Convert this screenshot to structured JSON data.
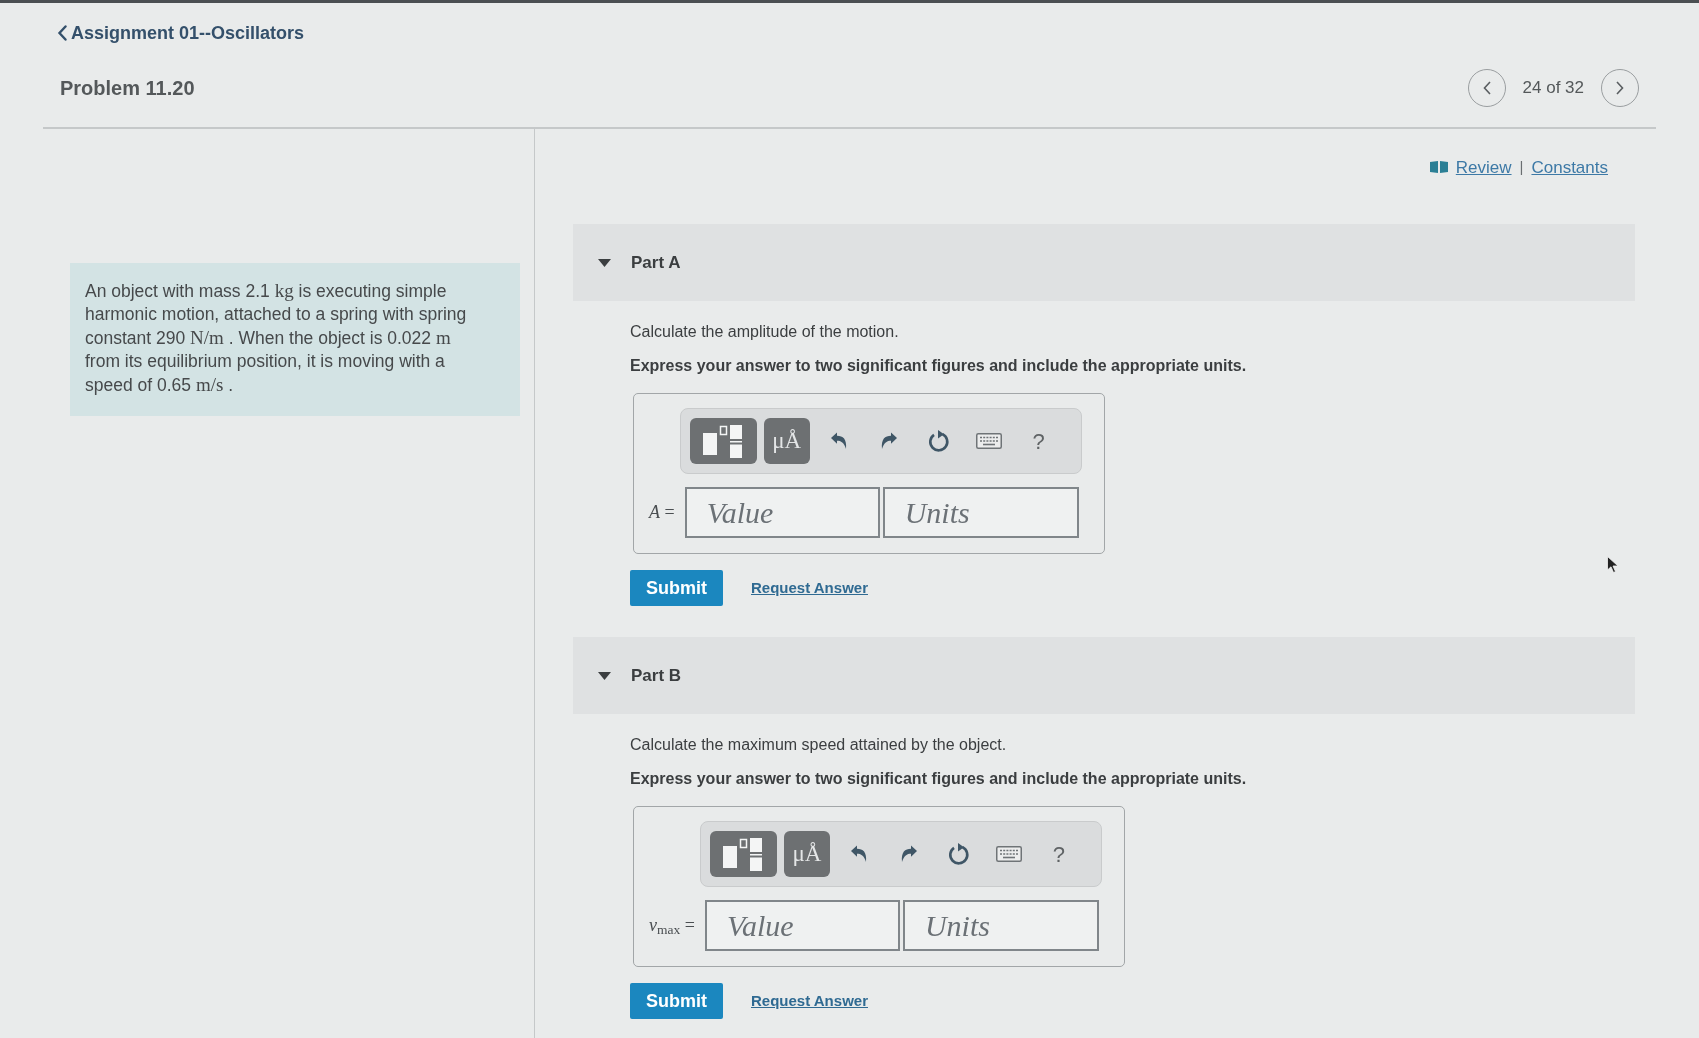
{
  "header": {
    "back_link": "Assignment 01--Oscillators",
    "title": "Problem 11.20",
    "position": "24 of 32"
  },
  "problem": {
    "segments": [
      {
        "kind": "text",
        "text": "An object with mass 2.1 "
      },
      {
        "kind": "math",
        "text": "kg"
      },
      {
        "kind": "text",
        "text": " is executing simple harmonic motion, attached to a spring with spring constant 290 "
      },
      {
        "kind": "math",
        "text": "N/m"
      },
      {
        "kind": "text",
        "text": " . When the object is 0.022 "
      },
      {
        "kind": "math",
        "text": "m"
      },
      {
        "kind": "text",
        "text": " from its equilibrium position, it is moving with a speed of 0.65 "
      },
      {
        "kind": "math",
        "text": "m/s"
      },
      {
        "kind": "text",
        "text": " ."
      }
    ]
  },
  "resources": {
    "review_link": "Review",
    "separator": "|",
    "constants_link": "Constants"
  },
  "parts": [
    {
      "label": "Part A",
      "expanded": true,
      "question": "Calculate the amplitude of the motion.",
      "instruction": "Express your answer to two significant figures and include the appropriate units.",
      "toolbar": {
        "units_button": "μÅ",
        "help_button": "?"
      },
      "variable": "*A* =",
      "value_placeholder": "Value",
      "units_placeholder": "Units",
      "submit": "Submit",
      "request_answer": "Request Answer"
    },
    {
      "label": "Part B",
      "expanded": true,
      "question": "Calculate the maximum speed attained by the object.",
      "instruction": "Express your answer to two significant figures and include the appropriate units.",
      "toolbar": {
        "units_button": "μÅ",
        "help_button": "?"
      },
      "variable": "*v*$_{max}$ =",
      "value_placeholder": "Value",
      "units_placeholder": "Units",
      "submit": "Submit",
      "request_answer": "Request Answer"
    }
  ]
}
